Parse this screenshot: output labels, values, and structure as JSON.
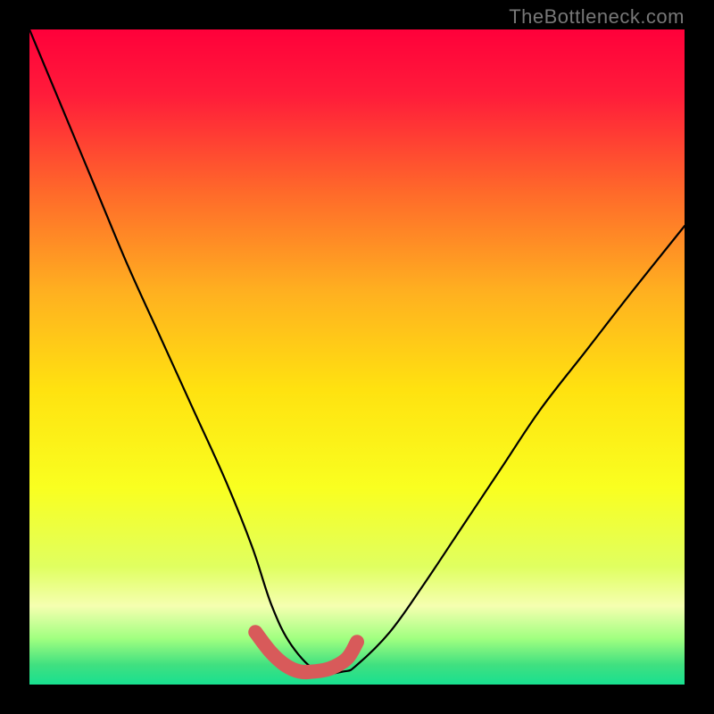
{
  "watermark": "TheBottleneck.com",
  "chart_data": {
    "type": "line",
    "title": "",
    "xlabel": "",
    "ylabel": "",
    "xlim": [
      0,
      100
    ],
    "ylim": [
      0,
      100
    ],
    "gradient_stops": [
      {
        "offset": 0.0,
        "color": "#ff003a"
      },
      {
        "offset": 0.1,
        "color": "#ff1c3a"
      },
      {
        "offset": 0.25,
        "color": "#ff6a2a"
      },
      {
        "offset": 0.4,
        "color": "#ffb020"
      },
      {
        "offset": 0.55,
        "color": "#ffe210"
      },
      {
        "offset": 0.7,
        "color": "#f9ff20"
      },
      {
        "offset": 0.82,
        "color": "#e0ff60"
      },
      {
        "offset": 0.88,
        "color": "#f5ffb0"
      },
      {
        "offset": 0.93,
        "color": "#a0ff80"
      },
      {
        "offset": 0.97,
        "color": "#40e080"
      },
      {
        "offset": 1.0,
        "color": "#18e090"
      }
    ],
    "bottleneck_curve": {
      "x": [
        0,
        5,
        10,
        15,
        20,
        25,
        30,
        34,
        37,
        40,
        44,
        48,
        50,
        55,
        60,
        66,
        72,
        78,
        85,
        92,
        100
      ],
      "y": [
        100,
        88,
        76,
        64,
        53,
        42,
        31,
        21,
        12,
        6,
        2,
        2,
        3,
        8,
        15,
        24,
        33,
        42,
        51,
        60,
        70
      ]
    },
    "red_marker": {
      "x": [
        34.5,
        36.8,
        39.0,
        41.2,
        43.5,
        46.0,
        48.5,
        50.0
      ],
      "y": [
        8.0,
        5.0,
        3.0,
        2.0,
        2.0,
        2.5,
        4.0,
        6.5
      ]
    },
    "colors": {
      "curve": "#000000",
      "marker": "#d85a5a"
    }
  }
}
